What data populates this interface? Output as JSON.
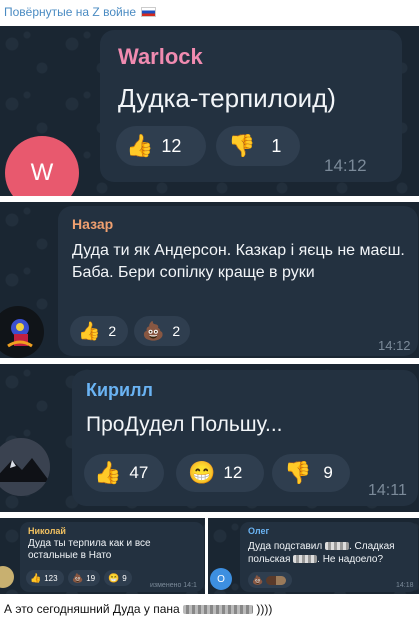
{
  "post": {
    "title": "Повёрнутые на Z войне"
  },
  "panels": [
    {
      "avatar_letter": "W",
      "name": "Warlock",
      "text": "Дудка-терпилоид)",
      "reactions": [
        {
          "emoji": "👍",
          "count": "12"
        },
        {
          "emoji": "👎",
          "count": "1"
        }
      ],
      "time": "14:12"
    },
    {
      "name": "Назар",
      "text": "Дуда ти як Андерсон. Казкар і яєць не маєш. Баба. Бери сопілку краще в руки",
      "reactions": [
        {
          "emoji": "👍",
          "count": "2"
        },
        {
          "emoji": "💩",
          "count": "2"
        }
      ],
      "time": "14:12"
    },
    {
      "name": "Кирилл",
      "text": "ПроДудел Польшу...",
      "reactions": [
        {
          "emoji": "👍",
          "count": "47"
        },
        {
          "emoji": "😁",
          "count": "12"
        },
        {
          "emoji": "👎",
          "count": "9"
        }
      ],
      "time": "14:11"
    },
    {
      "name": "Николай",
      "text": "Дуда ты терпила как и все остальные в Нато",
      "reactions": [
        {
          "emoji": "👍",
          "count": "123"
        },
        {
          "emoji": "💩",
          "count": "19"
        },
        {
          "emoji": "😁",
          "count": "9"
        }
      ],
      "time": "изменено 14:1"
    },
    {
      "avatar_letter": "О",
      "name": "Олег",
      "text_a": "Дуда подставил",
      "text_b": ". Сладкая",
      "text_c": "польская",
      "text_d": ". Не надоело?",
      "reactions": [
        {
          "emoji": "💩"
        }
      ],
      "time": "14:18"
    }
  ],
  "caption": {
    "text_a": "А это сегодняшний Дуда у пана",
    "text_b": "))))"
  },
  "colors": {
    "warlock": "#f08bb0",
    "nazar": "#f0a070",
    "kirill": "#6ab3f3",
    "nikolai": "#f0c060",
    "oleg": "#6ab3f3",
    "avatar_w": "#e8596e",
    "avatar_o": "#3d8fe0"
  }
}
